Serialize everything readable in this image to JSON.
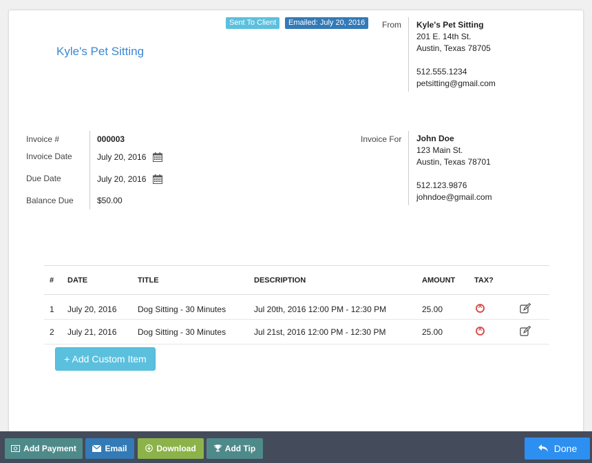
{
  "badges": {
    "sent": "Sent To Client",
    "emailed": "Emailed: July 20, 2016"
  },
  "company": {
    "name": "Kyle's Pet Sitting"
  },
  "from": {
    "label": "From",
    "name": "Kyle's Pet Sitting",
    "address1": "201 E. 14th St.",
    "address2": "Austin, Texas 78705",
    "phone": "512.555.1234",
    "email": "petsitting@gmail.com"
  },
  "invoice": {
    "number_label": "Invoice #",
    "number": "000003",
    "date_label": "Invoice Date",
    "date": "July 20, 2016",
    "due_label": "Due Date",
    "due": "July 20, 2016",
    "balance_label": "Balance Due",
    "balance": "$50.00"
  },
  "to": {
    "label": "Invoice For",
    "name": "John Doe",
    "address1": "123 Main St.",
    "address2": "Austin, Texas 78701",
    "phone": "512.123.9876",
    "email": "johndoe@gmail.com"
  },
  "table": {
    "headers": [
      "#",
      "DATE",
      "TITLE",
      "DESCRIPTION",
      "AMOUNT",
      "TAX?"
    ],
    "rows": [
      {
        "num": "1",
        "date": "July 20, 2016",
        "title": "Dog Sitting - 30 Minutes",
        "description": "Jul 20th, 2016 12:00 PM - 12:30 PM",
        "amount": "25.00"
      },
      {
        "num": "2",
        "date": "July 21, 2016",
        "title": "Dog Sitting - 30 Minutes",
        "description": "Jul 21st, 2016 12:00 PM - 12:30 PM",
        "amount": "25.00"
      }
    ]
  },
  "add_custom_label": "+ Add Custom Item",
  "actions": {
    "add_payment": "Add Payment",
    "email": "Email",
    "download": "Download",
    "add_tip": "Add Tip",
    "done": "Done"
  },
  "colors": {
    "accent": "#3a87d4",
    "info": "#5bc0de",
    "primary": "#337ab7",
    "success": "#8cb34a",
    "danger": "#d9534f",
    "bar": "#444b5a"
  }
}
